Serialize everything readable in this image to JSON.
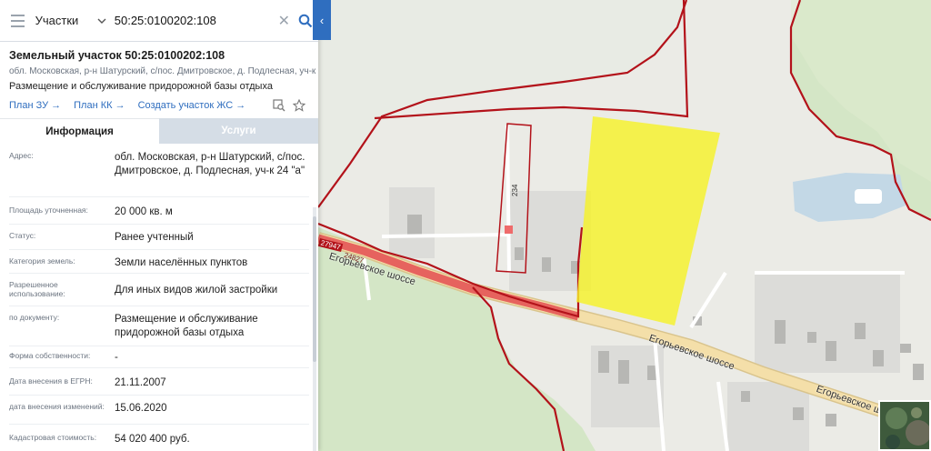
{
  "search": {
    "type_label": "Участки",
    "query": "50:25:0100202:108"
  },
  "card": {
    "title": "Земельный участок 50:25:0100202:108",
    "address": "обл. Московская, р-н Шатурский, с/пос. Дмитровское, д. Подлесная, уч-к 24 \"а\"",
    "purpose": "Размещение и обслуживание придорожной базы отдыха",
    "links": [
      "План ЗУ →",
      "План КК →",
      "Создать участок ЖС →"
    ]
  },
  "tabs": [
    {
      "label": "Информация",
      "active": true
    },
    {
      "label": "Услуги",
      "active": false
    }
  ],
  "info_rows": [
    {
      "label": "Адрес:",
      "value": "обл. Московская, р-н Шатурский, с/пос. Дмитровское, д. Подлесная, уч-к 24 \"а\""
    },
    {
      "label": "Площадь уточненная:",
      "value": "20 000 кв. м"
    },
    {
      "label": "Статус:",
      "value": "Ранее учтенный"
    },
    {
      "label": "Категория земель:",
      "value": "Земли населённых пунктов"
    },
    {
      "label": "Разрешенное использование:",
      "value": "Для иных видов жилой застройки"
    },
    {
      "label": "по документу:",
      "value": "Размещение и обслуживание придорожной базы отдыха"
    },
    {
      "label": "Форма собственности:",
      "value": "-"
    },
    {
      "label": "Дата внесения в ЕГРН:",
      "value": "21.11.2007"
    },
    {
      "label": "дата внесения изменений:",
      "value": "15.06.2020"
    },
    {
      "label": "Кадастровая стоимость:",
      "value": "54 020 400 руб."
    }
  ],
  "map": {
    "road_labels": [
      "Егорьевское шоссе",
      "Егорьевское шоссе",
      "Егорьевское шоссе"
    ],
    "road_numbers": [
      "27947",
      "24827"
    ],
    "parcel_number": "234",
    "colors": {
      "boundary": "#b3121a",
      "highlight": "#f5f12a",
      "road": "#f1d79f",
      "road_red": "#e24b4b",
      "forest": "#cfe3c2",
      "water": "#c3d8e6",
      "accent": "#2f6ebf"
    }
  }
}
